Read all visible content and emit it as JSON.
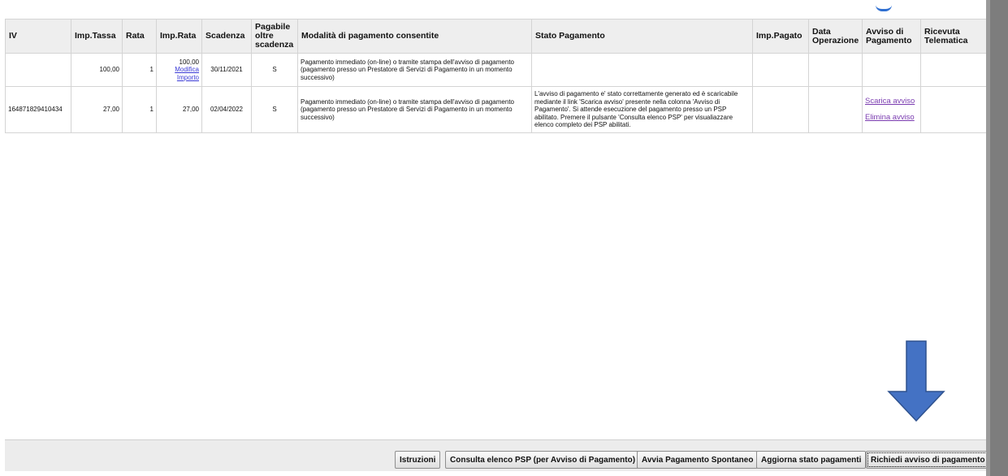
{
  "table": {
    "headers": {
      "iuv": "IV",
      "imp_tassa": "Imp.Tassa",
      "rata": "Rata",
      "imp_rata": "Imp.Rata",
      "scadenza": "Scadenza",
      "pagabile": [
        "Pagabile",
        "oltre",
        "scadenza"
      ],
      "modalita": "Modalità di pagamento consentite",
      "stato": "Stato Pagamento",
      "imp_pagato": "Imp.Pagato",
      "data_operazione": [
        "Data",
        "Operazione"
      ],
      "avviso": [
        "Avviso di",
        "Pagamento"
      ],
      "ricevuta": [
        "Ricevuta",
        "Telematica"
      ]
    },
    "rows": [
      {
        "iuv": "",
        "imp_tassa": "100,00",
        "rata": "1",
        "imp_rata": "100,00",
        "modifica_link": [
          "Modifica",
          "Importo"
        ],
        "scadenza": "30/11/2021",
        "pagabile": "S",
        "modalita": "Pagamento immediato (on-line) o tramite stampa dell'avviso di pagamento (pagamento presso un Prestatore di Servizi di Pagamento in un momento successivo)",
        "stato": "",
        "imp_pagato": "",
        "data_operazione": "",
        "ricevuta": ""
      },
      {
        "iuv": "164871829410434",
        "imp_tassa": "27,00",
        "rata": "1",
        "imp_rata": "27,00",
        "scadenza": "02/04/2022",
        "pagabile": "S",
        "modalita": "Pagamento immediato (on-line) o tramite stampa dell'avviso di pagamento (pagamento presso un Prestatore di Servizi di Pagamento in un momento successivo)",
        "stato": "L'avviso di pagamento e' stato correttamente generato ed è scaricabile mediante il link 'Scarica avviso' presente nella colonna 'Avviso di Pagamento'. Si attende esecuzione del pagamento presso un PSP abilitato. Premere il pulsante 'Consulta elenco PSP' per visualiazzare elenco completo dei PSP abilitati.",
        "imp_pagato": "",
        "data_operazione": "",
        "scarica_avviso": "Scarica avviso",
        "elimina_avviso": "Elimina avviso",
        "ricevuta": ""
      }
    ]
  },
  "buttons": {
    "istruzioni": "Istruzioni",
    "consulta_psp": "Consulta elenco PSP (per Avviso di Pagamento)",
    "avvia_spontaneo": "Avvia Pagamento Spontaneo",
    "aggiorna_stato": "Aggiorna stato pagamenti",
    "richiedi_avviso": "Richiedi avviso di pagamento"
  },
  "colors": {
    "arrow": "#4472c4",
    "link": "#3b3bd6",
    "visited_link": "#7a3bb0",
    "header_bg": "#eeeeee",
    "scrollbar": "#7d7d7d"
  },
  "icons": {
    "annotation": "down-arrow-icon"
  }
}
